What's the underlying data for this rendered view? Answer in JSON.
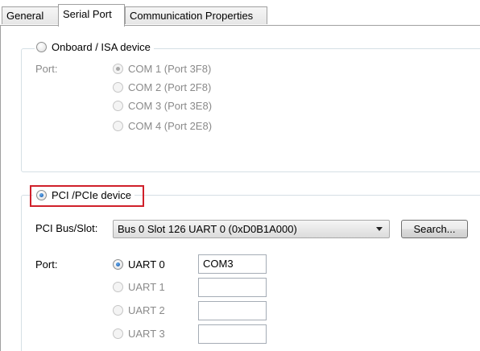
{
  "tabs": [
    {
      "label": "General"
    },
    {
      "label": "Serial Port"
    },
    {
      "label": "Communication Properties"
    }
  ],
  "onboard": {
    "legend": "Onboard / ISA device",
    "port_label": "Port:",
    "ports": [
      {
        "label": "COM 1 (Port 3F8)",
        "checked": true
      },
      {
        "label": "COM 2 (Port 2F8)",
        "checked": false
      },
      {
        "label": "COM 3 (Port 3E8)",
        "checked": false
      },
      {
        "label": "COM 4 (Port 2E8)",
        "checked": false
      }
    ]
  },
  "pci": {
    "legend": "PCI /PCIe device",
    "bus_slot_label": "PCI Bus/Slot:",
    "bus_slot_value": "Bus 0 Slot 126 UART 0 (0xD0B1A000)",
    "search_label": "Search...",
    "port_label": "Port:",
    "uarts": [
      {
        "label": "UART 0",
        "checked": true,
        "value": "COM3"
      },
      {
        "label": "UART 1",
        "checked": false,
        "value": ""
      },
      {
        "label": "UART 2",
        "checked": false,
        "value": ""
      },
      {
        "label": "UART 3",
        "checked": false,
        "value": ""
      }
    ]
  },
  "colors": {
    "highlight": "#d0202a",
    "disabled_text": "#8a8a8a"
  }
}
